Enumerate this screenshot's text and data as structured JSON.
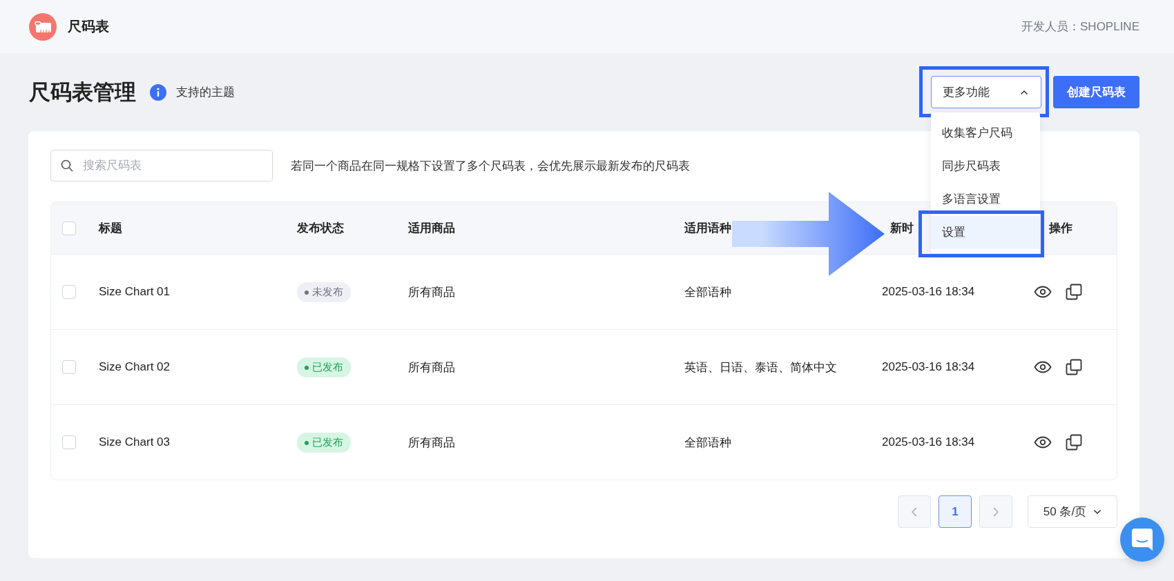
{
  "app": {
    "title": "尺码表",
    "developer": "开发人员：SHOPLINE"
  },
  "page": {
    "title": "尺码表管理",
    "themes_link": "支持的主题"
  },
  "more_menu": {
    "label": "更多功能",
    "expanded": true,
    "items": [
      {
        "label": "收集客户尺码",
        "selected": false
      },
      {
        "label": "同步尺码表",
        "selected": false
      },
      {
        "label": "多语言设置",
        "selected": false
      },
      {
        "label": "设置",
        "selected": true
      }
    ]
  },
  "create_button": "创建尺码表",
  "search": {
    "placeholder": "搜索尺码表"
  },
  "notice": "若同一个商品在同一规格下设置了多个尺码表，会优先展示最新发布的尺码表",
  "table": {
    "all_checked": false,
    "columns": [
      "标题",
      "发布状态",
      "适用商品",
      "适用语种",
      "新时",
      "操作"
    ],
    "rows": [
      {
        "checked": false,
        "title": "Size Chart 01",
        "status": {
          "label": "未发布",
          "published": false
        },
        "products": "所有商品",
        "languages": "全部语种",
        "updated": "2025-03-16 18:34"
      },
      {
        "checked": false,
        "title": "Size Chart 02",
        "status": {
          "label": "已发布",
          "published": true
        },
        "products": "所有商品",
        "languages": "英语、日语、泰语、简体中文",
        "updated": "2025-03-16 18:34"
      },
      {
        "checked": false,
        "title": "Size Chart 03",
        "status": {
          "label": "已发布",
          "published": true
        },
        "products": "所有商品",
        "languages": "全部语种",
        "updated": "2025-03-16 18:34"
      }
    ]
  },
  "pagination": {
    "pages": [
      {
        "label": "1",
        "selected": true
      }
    ],
    "page_size": "50 条/页"
  }
}
